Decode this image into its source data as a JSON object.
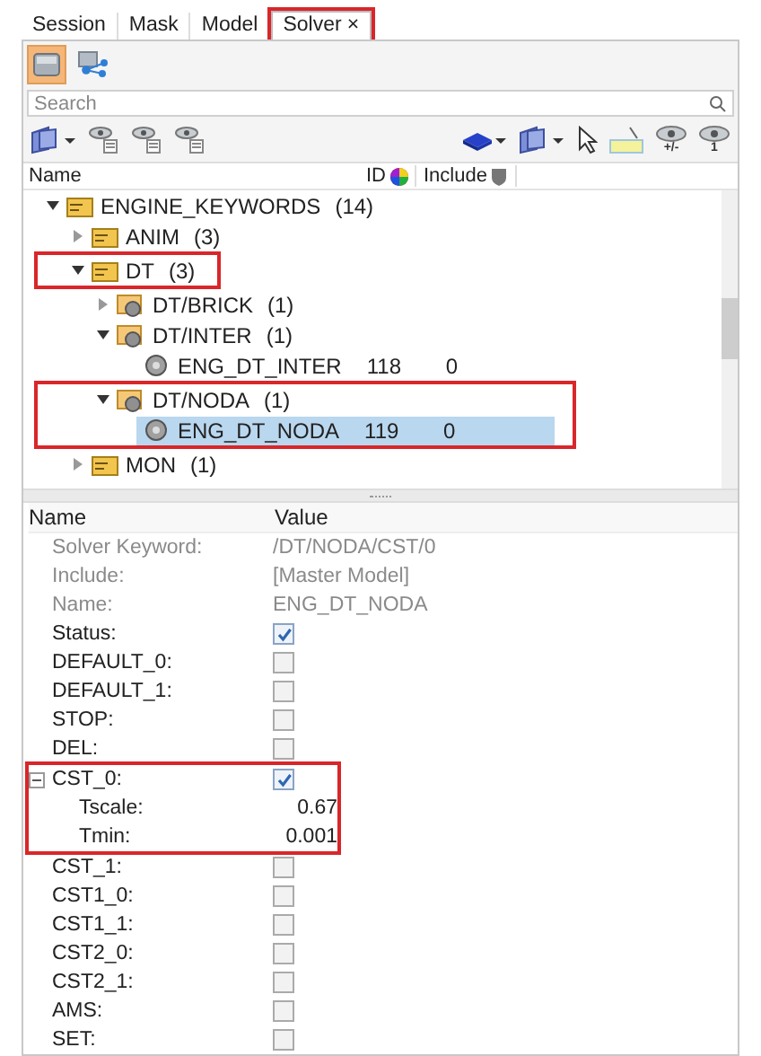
{
  "tabs": [
    {
      "label": "Session",
      "selected": false
    },
    {
      "label": "Mask",
      "selected": false
    },
    {
      "label": "Model",
      "selected": false
    },
    {
      "label": "Solver",
      "selected": true,
      "close": "×",
      "highlighted": true
    }
  ],
  "toolbar": [
    {
      "kind": "folder",
      "selected": true
    },
    {
      "kind": "network",
      "selected": false
    }
  ],
  "search": {
    "placeholder": "Search"
  },
  "view_buttons": [
    {
      "badge": "+/-"
    },
    {
      "badge": "1"
    }
  ],
  "tree": {
    "columns": [
      "Name",
      "ID",
      "Include"
    ],
    "nodes": [
      {
        "name": "ENGINE_KEYWORDS",
        "count": "(14)",
        "kind": "folder",
        "expanded": true,
        "selected": false,
        "children": [
          {
            "name": "ANIM",
            "count": "(3)",
            "kind": "folder",
            "expanded": false,
            "selected": false
          },
          {
            "name": "DT",
            "count": "(3)",
            "kind": "folder",
            "expanded": true,
            "highlighted": true,
            "selected": false,
            "children": [
              {
                "name": "DT/BRICK",
                "count": "(1)",
                "kind": "group",
                "expanded": false,
                "selected": false
              },
              {
                "name": "DT/INTER",
                "count": "(1)",
                "kind": "group",
                "expanded": true,
                "selected": false,
                "children": [
                  {
                    "name": "ENG_DT_INTER",
                    "id": "118",
                    "include": "0",
                    "kind": "item",
                    "selected": false
                  }
                ]
              },
              {
                "name": "DT/NODA",
                "count": "(1)",
                "kind": "group",
                "expanded": true,
                "highlighted": true,
                "selected": false,
                "children": [
                  {
                    "name": "ENG_DT_NODA",
                    "id": "119",
                    "include": "0",
                    "kind": "item",
                    "highlighted": true,
                    "selected": true
                  }
                ]
              }
            ]
          },
          {
            "name": "MON",
            "count": "(1)",
            "kind": "folder",
            "expanded": false,
            "selected": false
          }
        ]
      }
    ]
  },
  "properties": {
    "columns": [
      "Name",
      "Value"
    ],
    "rows": [
      {
        "name": "Solver Keyword:",
        "kind": "text",
        "value": "/DT/NODA/CST/0",
        "disabled": true
      },
      {
        "name": "Include:",
        "kind": "text",
        "value": "[Master Model]",
        "disabled": true
      },
      {
        "name": "Name:",
        "kind": "text",
        "value": "ENG_DT_NODA",
        "disabled": true
      },
      {
        "name": "Status:",
        "kind": "checkbox",
        "checked": true
      },
      {
        "name": "DEFAULT_0:",
        "kind": "checkbox",
        "checked": false
      },
      {
        "name": "DEFAULT_1:",
        "kind": "checkbox",
        "checked": false
      },
      {
        "name": "STOP:",
        "kind": "checkbox",
        "checked": false
      },
      {
        "name": "DEL:",
        "kind": "checkbox",
        "checked": false
      },
      {
        "name": "CST_0:",
        "kind": "checkbox",
        "checked": true,
        "expanded": true,
        "highlighted": true,
        "children": [
          {
            "name": "Tscale:",
            "kind": "text",
            "value": "0.67",
            "disabled": false,
            "highlighted": true
          },
          {
            "name": "Tmin:",
            "kind": "text",
            "value": "0.001",
            "disabled": false,
            "highlighted": true
          }
        ]
      },
      {
        "name": "CST_1:",
        "kind": "checkbox",
        "checked": false
      },
      {
        "name": "CST1_0:",
        "kind": "checkbox",
        "checked": false
      },
      {
        "name": "CST1_1:",
        "kind": "checkbox",
        "checked": false
      },
      {
        "name": "CST2_0:",
        "kind": "checkbox",
        "checked": false
      },
      {
        "name": "CST2_1:",
        "kind": "checkbox",
        "checked": false
      },
      {
        "name": "AMS:",
        "kind": "checkbox",
        "checked": false
      },
      {
        "name": "SET:",
        "kind": "checkbox",
        "checked": false
      }
    ]
  }
}
